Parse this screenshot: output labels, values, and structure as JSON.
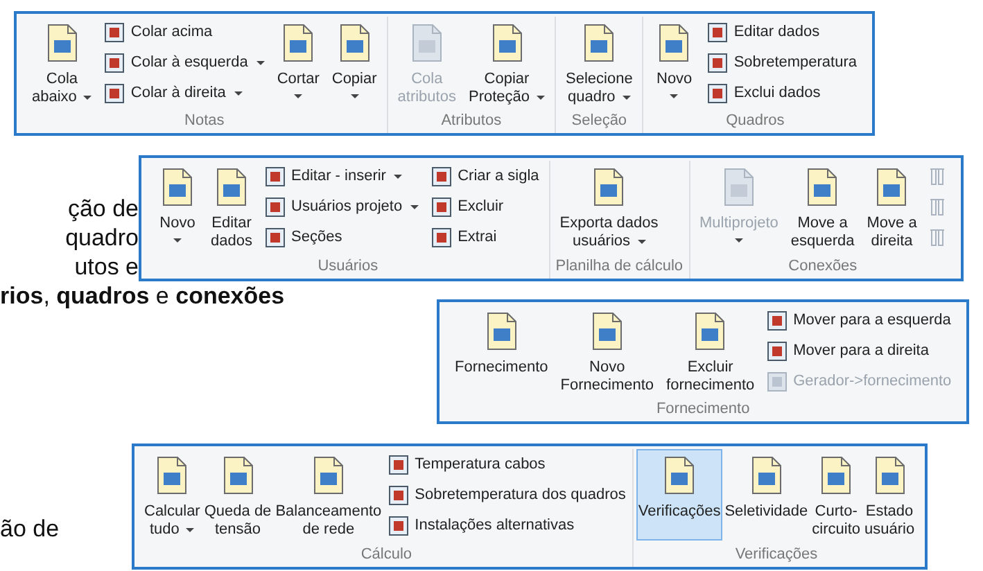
{
  "document_text": {
    "paragraph_1": [
      "ção de",
      "quadro",
      "utos e",
      "**rios**, **quadros** e **conexões**"
    ],
    "paragraph_2": [
      "ão de"
    ]
  },
  "ribbons": [
    {
      "groups": [
        {
          "label": "Notas",
          "items": [
            {
              "kind": "large",
              "lines": [
                "Cola",
                "abaixo"
              ],
              "dropdown": true,
              "disabled": false
            },
            {
              "kind": "stack",
              "items": [
                {
                  "label": "Colar acima",
                  "dropdown": false,
                  "disabled": false
                },
                {
                  "label": "Colar à esquerda",
                  "dropdown": true,
                  "disabled": false
                },
                {
                  "label": "Colar à direita",
                  "dropdown": true,
                  "disabled": false
                }
              ]
            },
            {
              "kind": "large",
              "lines": [
                "Cortar"
              ],
              "dropdown": true,
              "disabled": false
            },
            {
              "kind": "large",
              "lines": [
                "Copiar"
              ],
              "dropdown": true,
              "disabled": false
            }
          ]
        },
        {
          "label": "Atributos",
          "items": [
            {
              "kind": "large",
              "lines": [
                "Cola",
                "atributos"
              ],
              "dropdown": false,
              "disabled": true
            },
            {
              "kind": "large",
              "lines": [
                "Copiar",
                "Proteção"
              ],
              "dropdown": true,
              "disabled": false
            }
          ]
        },
        {
          "label": "Seleção",
          "items": [
            {
              "kind": "large",
              "lines": [
                "Selecione",
                "quadro"
              ],
              "dropdown": true,
              "disabled": false
            }
          ]
        },
        {
          "label": "Quadros",
          "items": [
            {
              "kind": "large",
              "lines": [
                "Novo"
              ],
              "dropdown": true,
              "disabled": false
            },
            {
              "kind": "stack",
              "items": [
                {
                  "label": "Editar dados",
                  "dropdown": false,
                  "disabled": false
                },
                {
                  "label": "Sobretemperatura",
                  "dropdown": false,
                  "disabled": false
                },
                {
                  "label": "Exclui dados",
                  "dropdown": false,
                  "disabled": false
                }
              ]
            }
          ]
        }
      ]
    },
    {
      "groups": [
        {
          "label": "Usuários",
          "items": [
            {
              "kind": "large",
              "lines": [
                "Novo"
              ],
              "dropdown": true,
              "disabled": false
            },
            {
              "kind": "large",
              "lines": [
                "Editar",
                "dados"
              ],
              "dropdown": false,
              "disabled": false
            },
            {
              "kind": "stack",
              "items": [
                {
                  "label": "Editar - inserir",
                  "dropdown": true,
                  "disabled": false
                },
                {
                  "label": "Usuários projeto",
                  "dropdown": true,
                  "disabled": false
                },
                {
                  "label": "Seções",
                  "dropdown": false,
                  "disabled": false
                }
              ]
            },
            {
              "kind": "stack",
              "items": [
                {
                  "label": "Criar a sigla",
                  "dropdown": false,
                  "disabled": false
                },
                {
                  "label": "Excluir",
                  "dropdown": false,
                  "disabled": false
                },
                {
                  "label": "Extrai",
                  "dropdown": false,
                  "disabled": false
                }
              ]
            }
          ]
        },
        {
          "label": "Planilha de cálculo",
          "items": [
            {
              "kind": "large",
              "lines": [
                "Exporta dados",
                "usuários"
              ],
              "dropdown": true,
              "disabled": false
            }
          ]
        },
        {
          "label": "Conexões",
          "items": [
            {
              "kind": "large",
              "lines": [
                "Multiprojeto"
              ],
              "dropdown": true,
              "disabled": true
            },
            {
              "kind": "large",
              "lines": [
                "Move a",
                "esquerda"
              ],
              "dropdown": false,
              "disabled": false
            },
            {
              "kind": "large",
              "lines": [
                "Move a",
                "direita"
              ],
              "dropdown": false,
              "disabled": false
            },
            {
              "kind": "icons",
              "items": [
                {
                  "disabled": true
                },
                {
                  "disabled": true
                },
                {
                  "disabled": true
                }
              ]
            }
          ]
        }
      ]
    },
    {
      "groups": [
        {
          "label": "Fornecimento",
          "items": [
            {
              "kind": "large",
              "lines": [
                "Fornecimento"
              ],
              "dropdown": false,
              "disabled": false
            },
            {
              "kind": "large",
              "lines": [
                "Novo",
                "Fornecimento"
              ],
              "dropdown": false,
              "disabled": false
            },
            {
              "kind": "large",
              "lines": [
                "Excluir",
                "fornecimento"
              ],
              "dropdown": false,
              "disabled": false
            },
            {
              "kind": "stack",
              "items": [
                {
                  "label": "Mover para a esquerda",
                  "dropdown": false,
                  "disabled": false
                },
                {
                  "label": "Mover para a direita",
                  "dropdown": false,
                  "disabled": false
                },
                {
                  "label": "Gerador->fornecimento",
                  "dropdown": false,
                  "disabled": true
                }
              ]
            }
          ]
        }
      ]
    },
    {
      "groups": [
        {
          "label": "Cálculo",
          "items": [
            {
              "kind": "large",
              "lines": [
                "Calcular",
                "tudo"
              ],
              "dropdown": true,
              "disabled": false
            },
            {
              "kind": "large",
              "lines": [
                "Queda de",
                "tensão"
              ],
              "dropdown": false,
              "disabled": false
            },
            {
              "kind": "large",
              "lines": [
                "Balanceamento",
                "de rede"
              ],
              "dropdown": false,
              "disabled": false
            },
            {
              "kind": "stack",
              "items": [
                {
                  "label": "Temperatura cabos",
                  "dropdown": false,
                  "disabled": false
                },
                {
                  "label": "Sobretemperatura dos quadros",
                  "dropdown": false,
                  "disabled": false
                },
                {
                  "label": "Instalações alternativas",
                  "dropdown": false,
                  "disabled": false
                }
              ]
            }
          ]
        },
        {
          "label": "Verificações",
          "items": [
            {
              "kind": "large",
              "lines": [
                "Verificações"
              ],
              "dropdown": false,
              "disabled": false,
              "highlighted": true
            },
            {
              "kind": "large",
              "lines": [
                "Seletividade"
              ],
              "dropdown": false,
              "disabled": false,
              "highlighted": false
            },
            {
              "kind": "large",
              "lines": [
                "Curto-",
                "circuito"
              ],
              "dropdown": false,
              "disabled": false,
              "highlighted": false
            },
            {
              "kind": "large",
              "lines": [
                "Estado",
                "usuário"
              ],
              "dropdown": false,
              "disabled": false,
              "highlighted": false
            }
          ]
        }
      ]
    }
  ]
}
